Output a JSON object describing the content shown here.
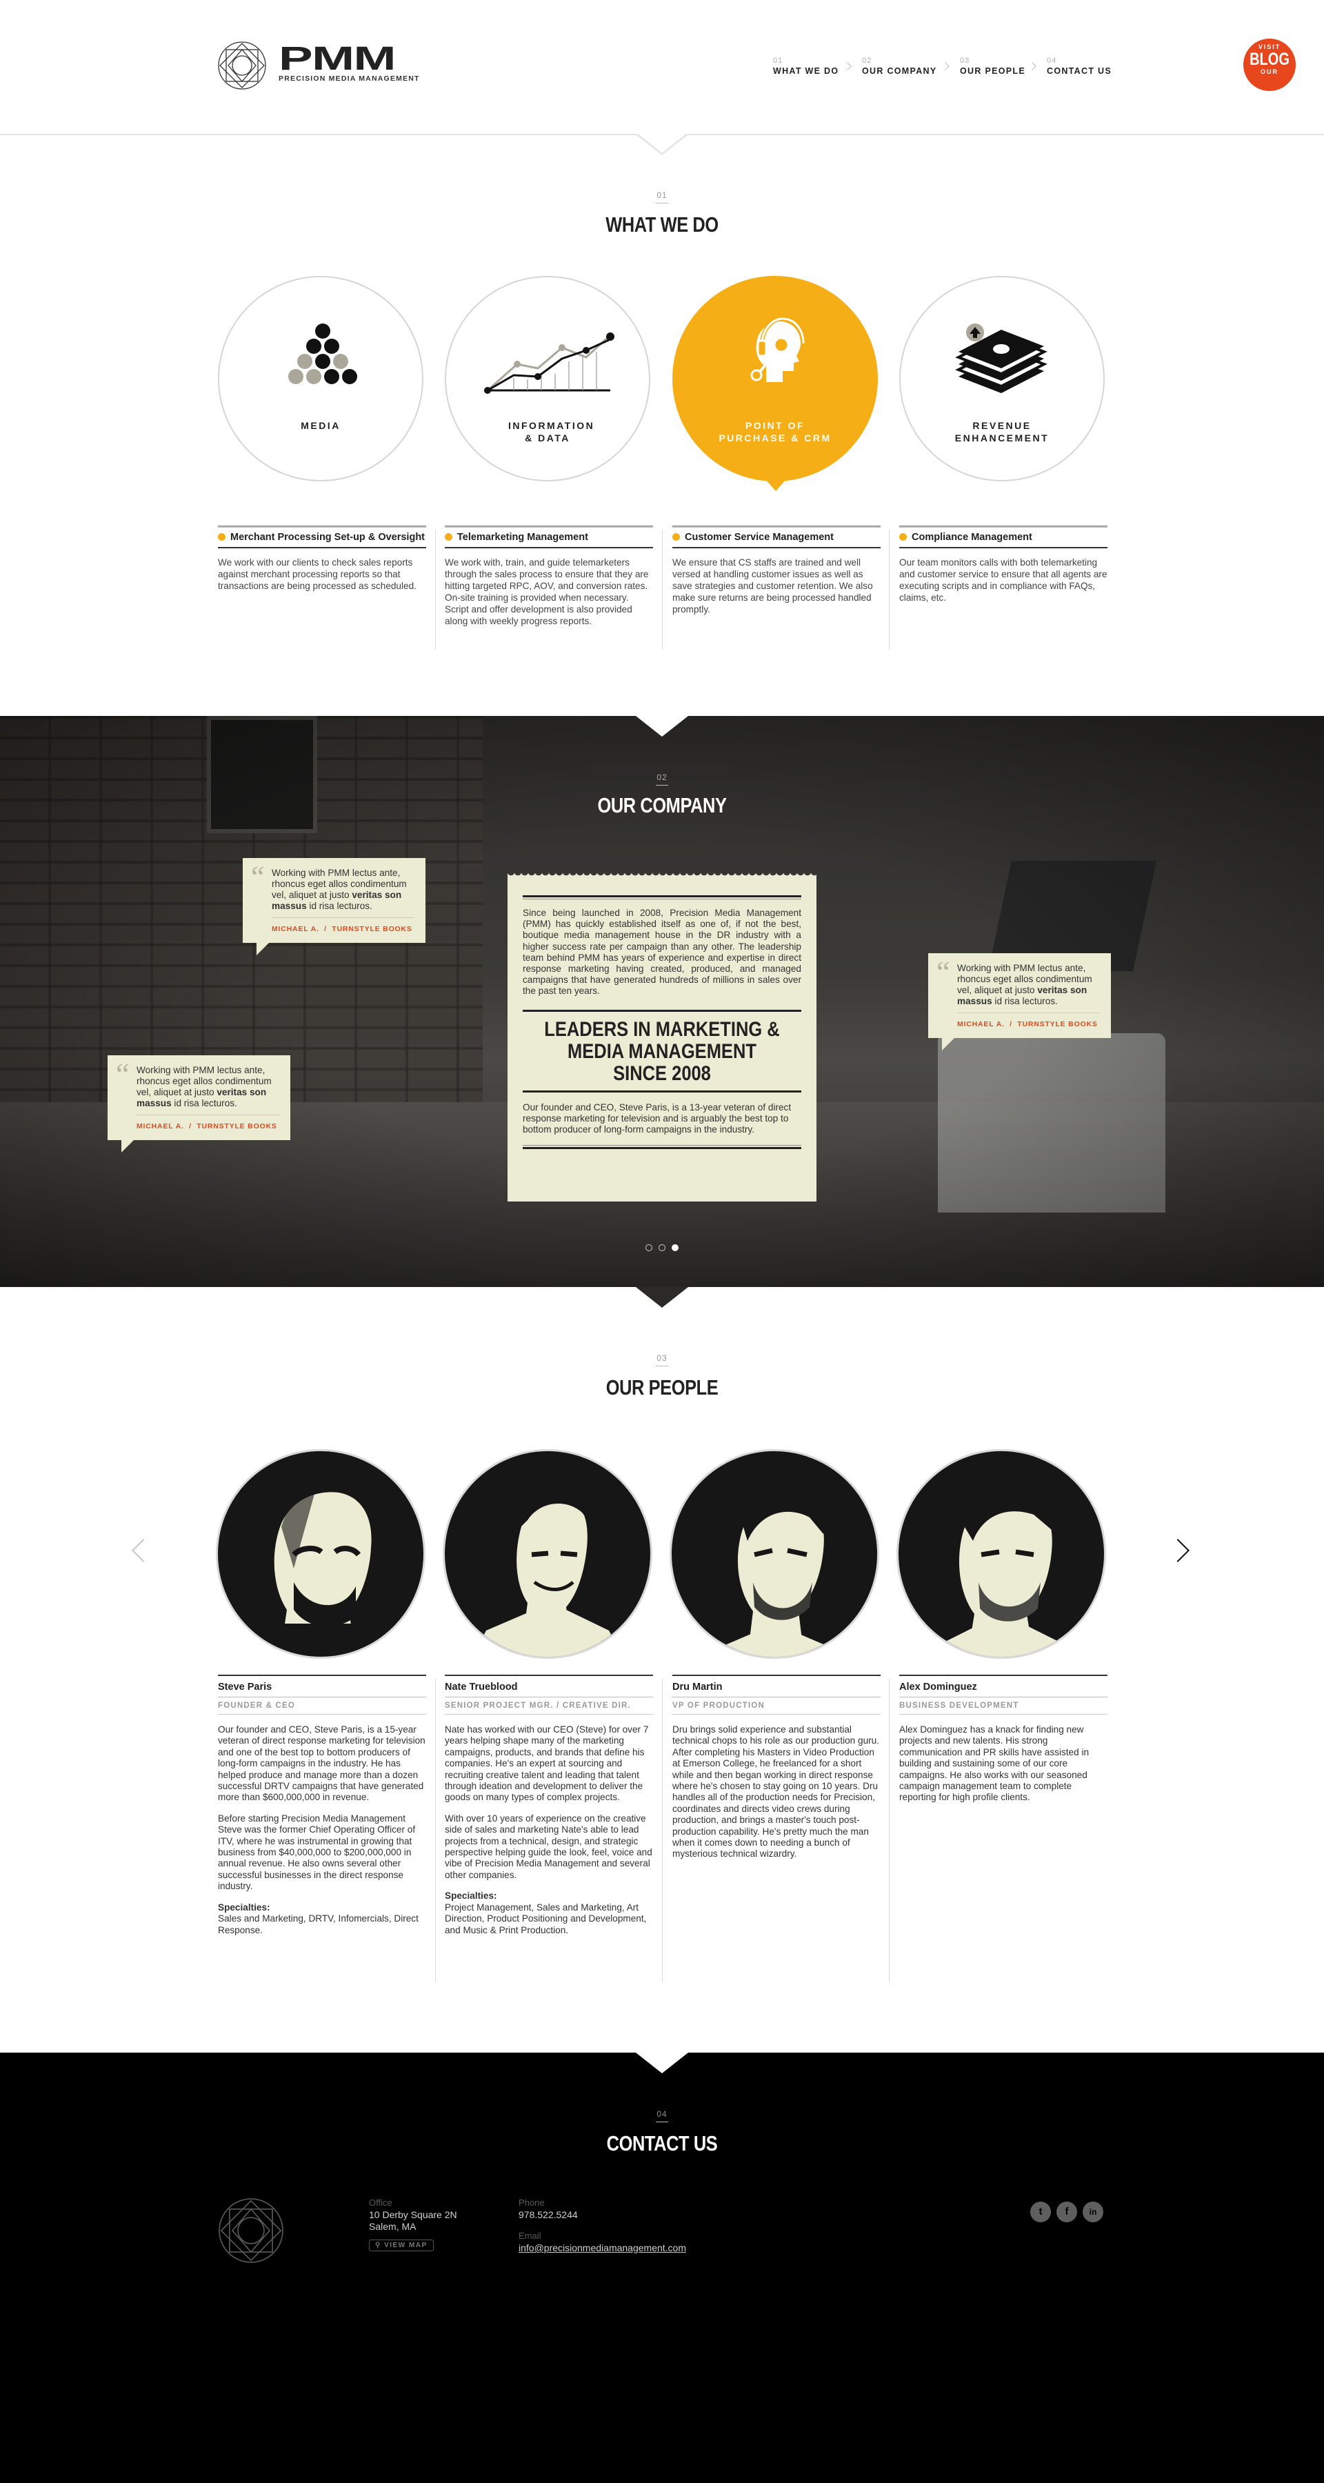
{
  "header": {
    "logo_name": "PMM",
    "logo_tagline": "PRECISION MEDIA MANAGEMENT",
    "nav": [
      {
        "num": "01",
        "label": "WHAT WE DO"
      },
      {
        "num": "02",
        "label": "OUR COMPANY"
      },
      {
        "num": "03",
        "label": "OUR PEOPLE"
      },
      {
        "num": "04",
        "label": "CONTACT US"
      }
    ],
    "blog_badge": {
      "top": "VISIT",
      "main": "BLOG",
      "bottom": "OUR"
    }
  },
  "colors": {
    "accent": "#f6ae16",
    "red": "#e8461d",
    "cream": "#ecebd3",
    "dark": "#000000"
  },
  "what_we_do": {
    "num": "01",
    "title": "WHAT WE DO",
    "circles": [
      {
        "label": "MEDIA",
        "icon": "pyramid-dots-icon"
      },
      {
        "label": "INFORMATION & DATA",
        "icon": "line-graph-icon"
      },
      {
        "label": "POINT OF PURCHASE & CRM",
        "icon": "headset-operator-icon",
        "active": true
      },
      {
        "label": "REVENUE ENHANCEMENT",
        "icon": "money-stack-icon"
      }
    ],
    "services": [
      {
        "title": "Merchant Processing Set-up & Oversight",
        "text": "We work with our clients to check sales reports against merchant processing reports so that transactions are being processed as scheduled."
      },
      {
        "title": "Telemarketing Management",
        "text": "We work with, train, and guide telemarketers through the sales process to ensure that they are hitting targeted RPC, AOV, and conversion rates. On-site training is provided when necessary. Script and offer development is also provided along with weekly progress reports."
      },
      {
        "title": "Customer Service Management",
        "text": "We ensure that CS staffs are trained and well versed at handling customer issues as well as save strategies and customer retention. We also make sure returns are being processed handled promptly."
      },
      {
        "title": "Compliance Management",
        "text": "Our team monitors calls with both telemarketing and customer service to ensure that all agents are executing scripts and in compliance with FAQs, claims, etc."
      }
    ]
  },
  "company": {
    "num": "02",
    "title": "OUR COMPANY",
    "intro": "Since being launched in 2008, Precision Media Management (PMM) has quickly established itself as one of, if not the best, boutique media management house in the DR industry with a higher success rate per campaign than any other. The leadership team behind PMM has years of experience and expertise in direct response marketing having created, produced, and managed campaigns that have generated hundreds of millions in sales over the past ten years.",
    "headline": "LEADERS IN MARKETING & MEDIA MANAGEMENT SINCE 2008",
    "body": "Our founder and CEO, Steve Paris, is a 13-year veteran of direct response marketing for television and is arguably the best top to bottom producer of long-form campaigns in the industry.",
    "quotes": [
      {
        "text_a": "Working with PMM lectus ante, rhoncus eget allos condimentum vel, aliquet at justo ",
        "bold": "veritas son massus",
        "text_b": " id risa lecturos.",
        "author": "MICHAEL A.",
        "source": "TURNSTYLE BOOKS"
      },
      {
        "text_a": "Working with PMM lectus ante, rhoncus eget allos condimentum vel, aliquet at justo ",
        "bold": "veritas son massus",
        "text_b": " id risa lecturos.",
        "author": "MICHAEL A.",
        "source": "TURNSTYLE BOOKS"
      },
      {
        "text_a": "Working with PMM lectus ante, rhoncus eget allos condimentum vel, aliquet at justo ",
        "bold": "veritas son massus",
        "text_b": " id risa lecturos.",
        "author": "MICHAEL A.",
        "source": "TURNSTYLE BOOKS"
      }
    ],
    "slider_dots": 3,
    "active_dot": 3
  },
  "people": {
    "num": "03",
    "title": "OUR PEOPLE",
    "members": [
      {
        "name": "Steve Paris",
        "role": "FOUNDER & CEO",
        "paragraphs": [
          "Our founder and CEO, Steve Paris, is a 15-year veteran of direct response marketing for television and one of the best top to bottom producers of long-form campaigns in the industry. He has helped produce and manage more than a dozen successful DRTV campaigns that have generated more than $600,000,000 in revenue.",
          "Before starting Precision Media Management Steve was the former Chief Operating Officer of ITV, where he was instrumental in growing that business from $40,000,000 to $200,000,000 in annual revenue. He also owns several other successful businesses in the direct response industry."
        ],
        "spec_label": "Specialties:",
        "spec": "Sales and Marketing, DRTV, Infomercials, Direct Response."
      },
      {
        "name": "Nate Trueblood",
        "role": "SENIOR PROJECT MGR. / CREATIVE DIR.",
        "paragraphs": [
          "Nate has worked with our CEO (Steve) for over 7 years helping shape many of the marketing campaigns, products, and brands that define his companies. He's an expert at sourcing and recruiting creative talent and leading that talent through ideation and development to deliver the goods on many types of complex projects.",
          "With over 10 years of experience on the creative side of sales and marketing Nate's able to lead projects from a technical, design, and strategic perspective helping guide the look, feel, voice and vibe of Precision Media Management and several other companies."
        ],
        "spec_label": "Specialties:",
        "spec": "Project Management, Sales and Marketing, Art Direction, Product Positioning and Development, and Music & Print Production."
      },
      {
        "name": "Dru Martin",
        "role": "VP OF PRODUCTION",
        "paragraphs": [
          "Dru brings solid experience and substantial technical chops to his role as our production guru. After completing his Masters in Video Production at Emerson College, he freelanced for a short while and then began working in direct response where he's chosen to stay going on 10 years. Dru handles all of the production needs for Precision, coordinates and directs video crews during production, and brings a master's touch post-production capability. He's pretty much the man when it comes down to needing a bunch of mysterious technical wizardry."
        ],
        "spec_label": "",
        "spec": ""
      },
      {
        "name": "Alex Dominguez",
        "role": "BUSINESS DEVELOPMENT",
        "paragraphs": [
          "Alex Dominguez has a knack for finding new projects and new talents.  His strong communication and PR skills have assisted in building and sustaining some of our core campaigns.  He also works with our seasoned campaign management team to complete reporting for high profile clients."
        ],
        "spec_label": "",
        "spec": ""
      }
    ]
  },
  "contact": {
    "num": "04",
    "title": "CONTACT US",
    "office_label": "Office",
    "address_1": "10 Derby Square 2N",
    "address_2": "Salem, MA",
    "map_button": "VIEW MAP",
    "phone_label": "Phone",
    "phone": "978.522.5244",
    "email_label": "Email",
    "email": "info@precisionmediamanagement.com",
    "social": [
      "twitter-icon",
      "facebook-icon",
      "linkedin-icon"
    ]
  }
}
